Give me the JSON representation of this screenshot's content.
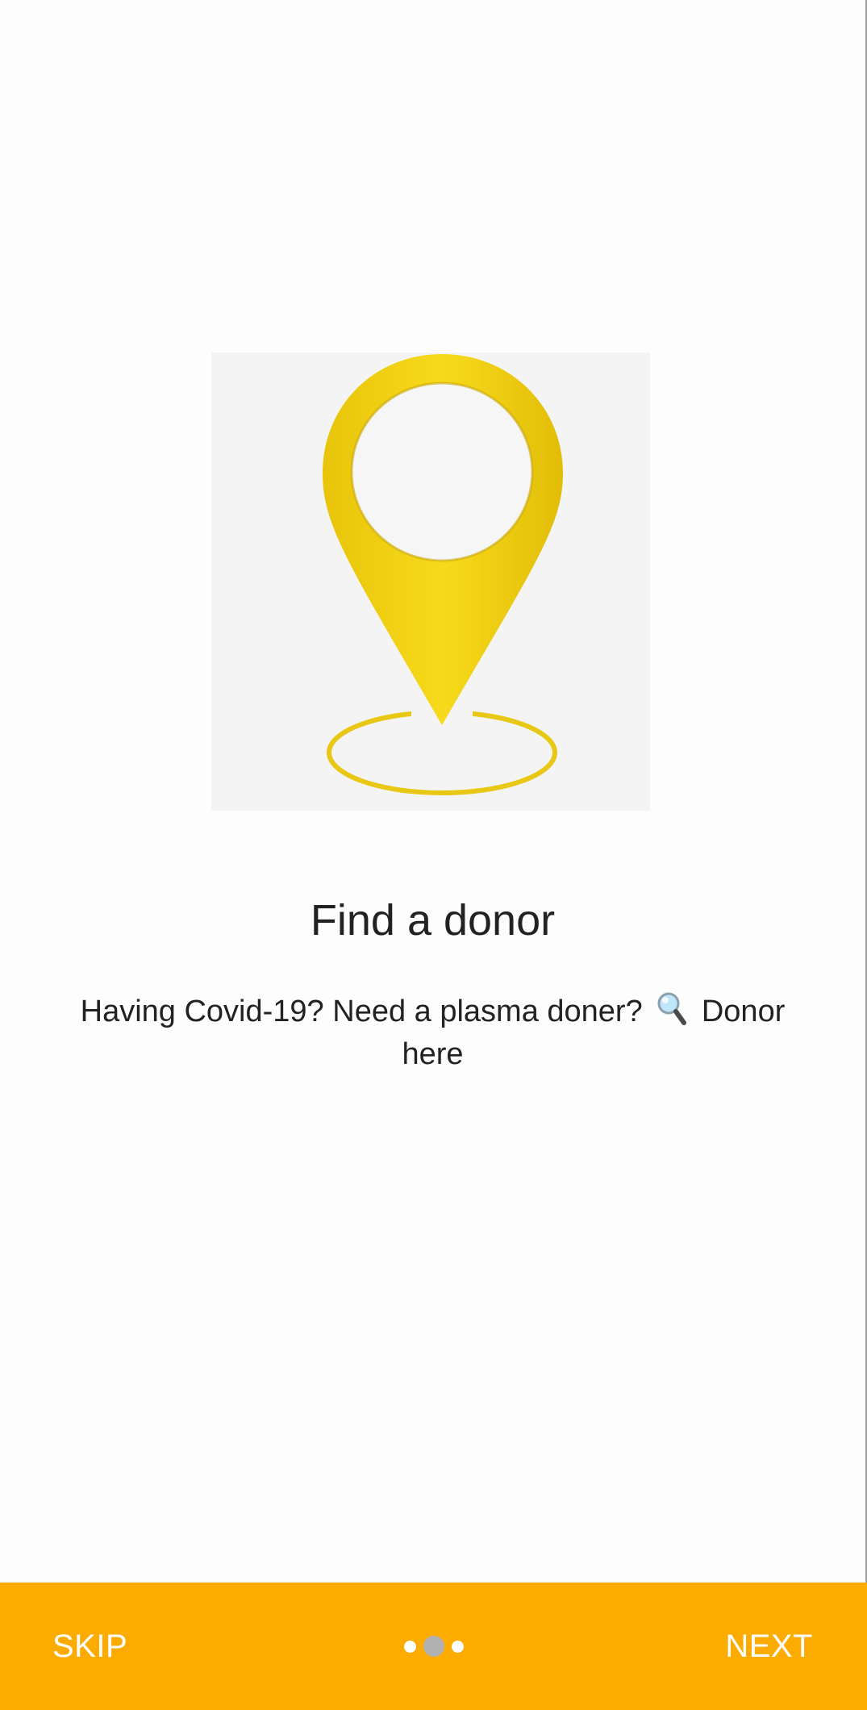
{
  "onboarding": {
    "title": "Find a donor",
    "description_before_icon": "Having Covid-19? Need a plasma doner?",
    "description_after_icon": "Donor here",
    "description_icon": "magnifying-glass-icon",
    "illustration_icon": "location-pin-icon",
    "page_count": 3,
    "current_page": 2
  },
  "bottom_bar": {
    "skip_label": "SKIP",
    "next_label": "NEXT",
    "background_color": "#fcab00"
  },
  "colors": {
    "pin_yellow": "#f4d316",
    "text": "#222222",
    "dot_active": "#b0b0b0",
    "dot_inactive": "#ffffff"
  }
}
